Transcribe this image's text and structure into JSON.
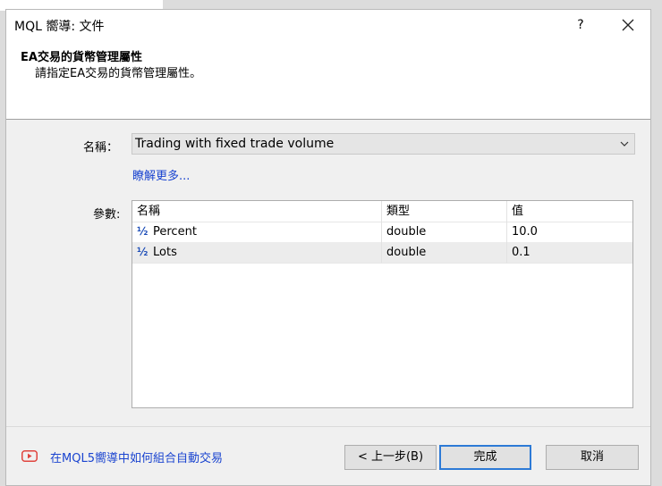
{
  "window": {
    "title": "MQL 嚮導: 文件",
    "help_label": "?"
  },
  "header": {
    "title": "EA交易的貨幣管理屬性",
    "subtitle": "請指定EA交易的貨幣管理屬性。"
  },
  "form": {
    "name_label": "名稱：",
    "name_value": "Trading with fixed trade volume",
    "learn_more": "瞭解更多...",
    "params_label": "參數:"
  },
  "params": {
    "columns": [
      "名稱",
      "類型",
      "值"
    ],
    "rows": [
      {
        "icon": "½",
        "name": "Percent",
        "type": "double",
        "value": "10.0"
      },
      {
        "icon": "½",
        "name": "Lots",
        "type": "double",
        "value": "0.1"
      }
    ]
  },
  "footer": {
    "video_link": "在MQL5嚮導中如何組合自動交易",
    "back_label": "< 上一步(B)",
    "finish_label": "完成",
    "cancel_label": "取消"
  },
  "colors": {
    "accent": "#2d7ad6",
    "link": "#1a44d0",
    "youtube": "#e0443e"
  }
}
